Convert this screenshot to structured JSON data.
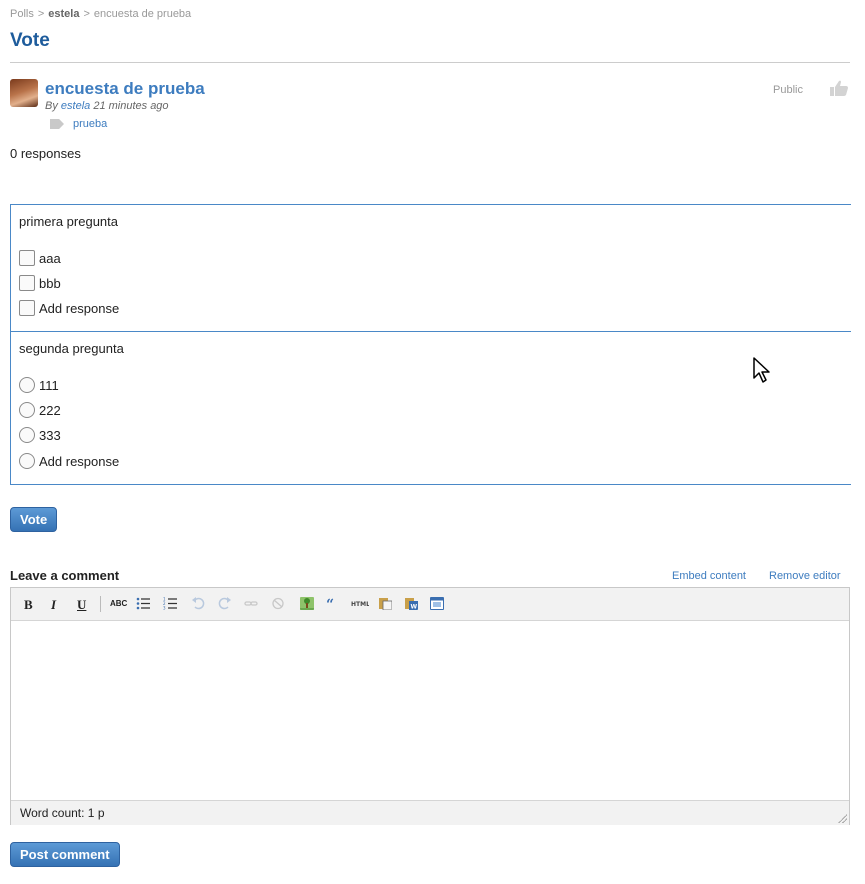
{
  "breadcrumb": {
    "polls": "Polls",
    "sep": ">",
    "user": "estela",
    "current": "encuesta de prueba"
  },
  "page_title": "Vote",
  "poll": {
    "title": "encuesta de prueba",
    "by_prefix": "By",
    "author": "estela",
    "time": "21 minutes ago",
    "tag": "prueba",
    "access": "Public",
    "responses": "0 responses"
  },
  "questions": [
    {
      "text": "primera pregunta",
      "options": [
        "aaa",
        "bbb",
        "Add response"
      ]
    },
    {
      "text": "segunda pregunta",
      "options": [
        "111",
        "222",
        "333",
        "Add response"
      ]
    }
  ],
  "vote_button": "Vote",
  "comment": {
    "label": "Leave a comment",
    "embed_link": "Embed content",
    "remove_link": "Remove editor",
    "toolbar": {
      "bold": "B",
      "italic": "I",
      "underline": "U",
      "spell": "ABC"
    },
    "word_count": "Word count: 1 p",
    "post_button": "Post comment"
  },
  "colors": {
    "accent": "#3d7cbf",
    "title": "#1e5c9c",
    "button": "#3572b4",
    "border": "#4a88c7"
  }
}
